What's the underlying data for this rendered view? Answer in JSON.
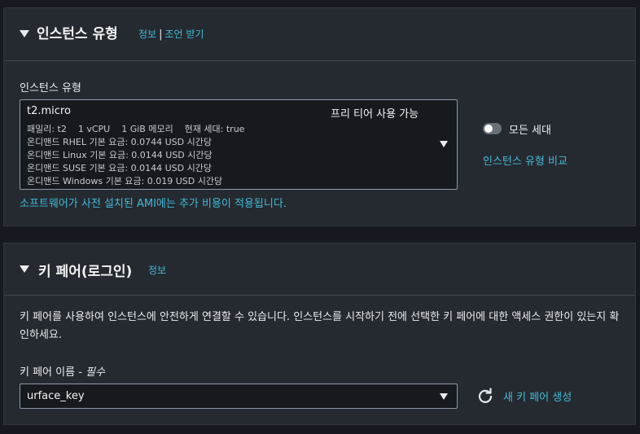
{
  "instance_panel": {
    "title": "인스턴스 유형",
    "info_link": "정보",
    "separator": "|",
    "advice_link": "조언 받기",
    "field_label": "인스턴스 유형",
    "selected": {
      "name": "t2.micro",
      "free_tier": "프리 티어 사용 가능",
      "lines": [
        "패밀리: t2    1 vCPU    1 GiB 메모리    현재 세대: true",
        "온디맨드 RHEL 기본 요금: 0.0744 USD 시간당",
        "온디맨드 Linux 기본 요금: 0.0144 USD 시간당",
        "온디맨드 SUSE 기본 요금: 0.0144 USD 시간당",
        "온디맨드 Windows 기본 요금: 0.019 USD 시간당"
      ]
    },
    "ami_note": "소프트웨어가 사전 설치된 AMI에는 추가 비용이 적용됩니다.",
    "all_generations_label": "모든 세대",
    "all_generations_on": false,
    "compare_link": "인스턴스 유형 비교"
  },
  "keypair_panel": {
    "title": "키 페어(로그인)",
    "info_link": "정보",
    "description": "키 페어를 사용하여 인스턴스에 안전하게 연결할 수 있습니다. 인스턴스를 시작하기 전에 선택한 키 페어에 대한 액세스 권한이 있는지 확인하세요.",
    "field_label": "키 페어 이름 - ",
    "required_label": "필수",
    "selected_key": "urface_key",
    "create_link": "새 키 페어 생성"
  },
  "colors": {
    "background": "#16191f",
    "panel": "#252a31",
    "link": "#44b9d6",
    "text": "#e9ebed"
  },
  "icons": [
    "caret-down-icon",
    "dropdown-arrow-icon",
    "refresh-icon",
    "toggle-switch"
  ]
}
